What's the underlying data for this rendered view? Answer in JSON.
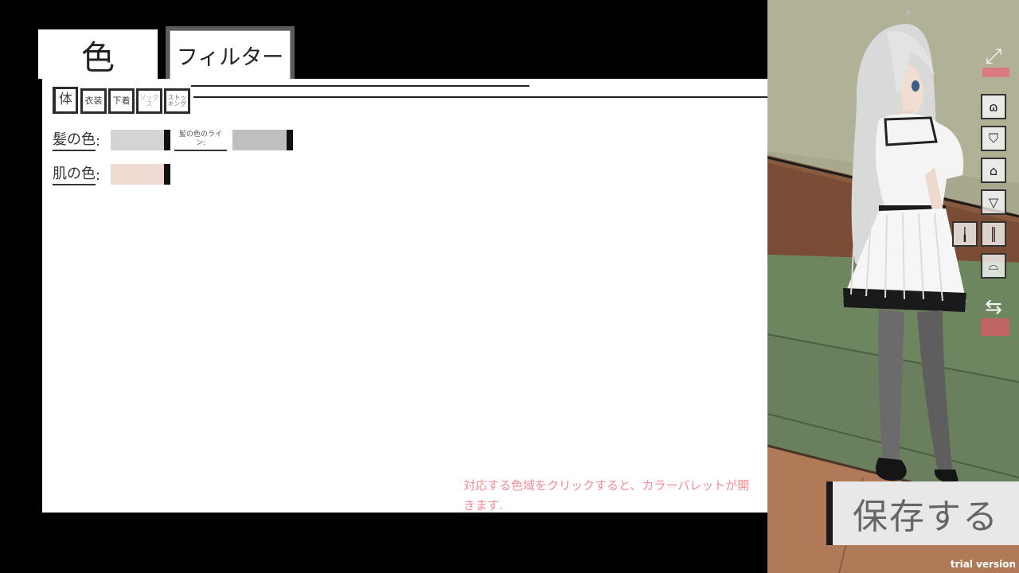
{
  "tabs": {
    "color": "色",
    "filter": "フィルター"
  },
  "subtabs": [
    {
      "label": "体"
    },
    {
      "label": "衣装"
    },
    {
      "label": "下着"
    },
    {
      "label": "ソックス"
    },
    {
      "label": "ストッキング"
    }
  ],
  "rows": {
    "hair": {
      "label": "髪の色",
      "colon": ":",
      "color": "#d4d4d4",
      "line_label": "髪の色のライン:",
      "line_color": "#bfbfbf"
    },
    "skin": {
      "label": "肌の色",
      "colon": ":",
      "color": "#f0d9d1"
    }
  },
  "hint": "対応する色域をクリックすると、カラーパレットが開きます.",
  "side_icons": [
    {
      "name": "expand-icon",
      "glyph": "⤢"
    },
    {
      "name": "hair-icon",
      "glyph": "ɷ"
    },
    {
      "name": "top-icon",
      "glyph": "⛉"
    },
    {
      "name": "skirt-icon",
      "glyph": "⌂"
    },
    {
      "name": "underwear-icon",
      "glyph": "▽"
    },
    {
      "name": "socks-icon",
      "glyph": "╽"
    },
    {
      "name": "stockings-icon",
      "glyph": "║"
    },
    {
      "name": "shoes-icon",
      "glyph": "⌓"
    },
    {
      "name": "swap-icon",
      "glyph": "⇆"
    }
  ],
  "save_label": "保存する",
  "trial_label": "trial version",
  "colors": {
    "hint": "#f28d93",
    "panel": "#ffffff",
    "background": "#000000"
  }
}
